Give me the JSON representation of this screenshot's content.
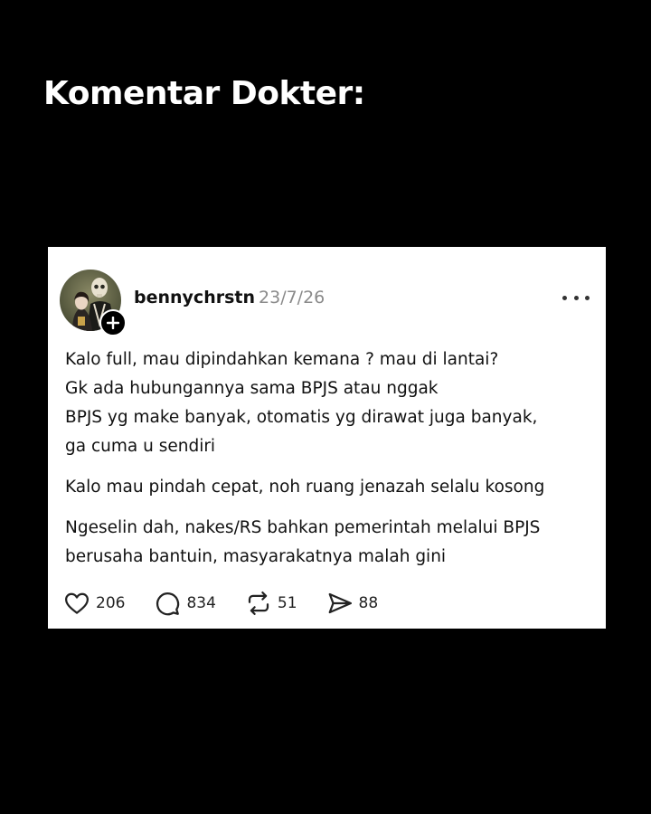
{
  "headline": "Komentar Dokter:",
  "post": {
    "username": "bennychrstn",
    "date": "23/7/26",
    "paragraphs": [
      [
        "Kalo full, mau dipindahkan kemana ? mau di lantai?",
        "Gk ada hubungannya sama BPJS atau nggak",
        "BPJS yg make banyak, otomatis yg dirawat juga banyak,",
        "ga cuma u sendiri"
      ],
      [
        "Kalo mau pindah cepat, noh ruang jenazah selalu kosong"
      ],
      [
        "Ngeselin dah, nakes/RS bahkan pemerintah melalui BPJS",
        "berusaha bantuin, masyarakatnya malah gini"
      ]
    ],
    "actions": {
      "likes": "206",
      "replies": "834",
      "reposts": "51",
      "shares": "88"
    },
    "icons": {
      "like": "heart-icon",
      "reply": "comment-icon",
      "repost": "repost-icon",
      "share": "send-icon",
      "more": "more-icon",
      "follow": "plus-icon"
    }
  },
  "colors": {
    "background": "#000000",
    "card": "#ffffff",
    "date": "#8a8a8a"
  }
}
